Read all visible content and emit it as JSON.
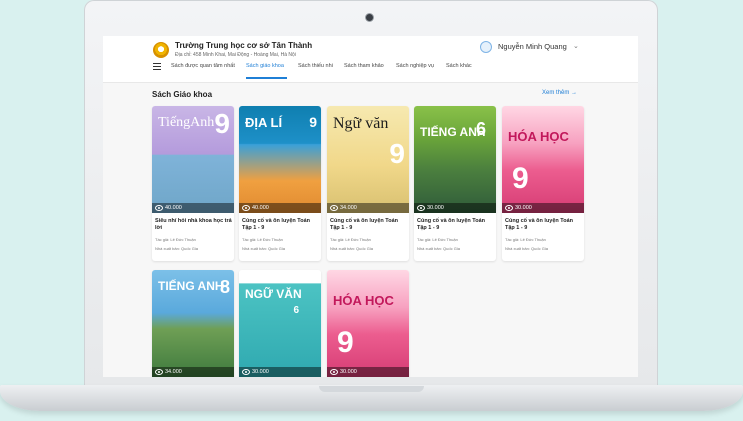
{
  "header": {
    "school_name": "Trường Trung học cơ sở Tân Thành",
    "school_address": "Địa chỉ: 458 Minh Khai, Mai Động - Hoàng Mai, Hà Nội",
    "user_name": "Nguyễn Minh Quang",
    "user_chevron": "⌄"
  },
  "nav": {
    "items": [
      {
        "label": "Sách được quan tâm nhất"
      },
      {
        "label": "Sách giáo khoa"
      },
      {
        "label": "Sách thiếu nhi"
      },
      {
        "label": "Sách tham khảo"
      },
      {
        "label": "Sách nghiệp vụ"
      },
      {
        "label": "Sách khác"
      }
    ],
    "active_index": 1
  },
  "section": {
    "title": "Sách Giáo khoa",
    "see_more": "Xem thêm →"
  },
  "books": [
    {
      "cover_title": "TiếngAnh",
      "cover_num": "9",
      "views": "40.000",
      "title": "Siêu nhí hỏi nhà khoa học trả lời",
      "author": "Tác giả: Lê Đức Thuận",
      "publisher": "Nhà xuất bản: Quốc Gia"
    },
    {
      "cover_title": "ĐỊA LÍ",
      "cover_num": "9",
      "views": "40.000",
      "title": "Củng cố và ôn luyện Toán Tập 1 - 9",
      "author": "Tác giả: Lê Đức Thuận",
      "publisher": "Nhà xuất bản: Quốc Gia"
    },
    {
      "cover_title": "Ngữ văn",
      "cover_num": "9",
      "views": "34.000",
      "title": "Củng cố và ôn luyện Toán Tập 1 - 9",
      "author": "Tác giả: Lê Đức Thuận",
      "publisher": "Nhà xuất bản: Quốc Gia"
    },
    {
      "cover_title": "TIẾNG ANH",
      "cover_num": "6",
      "views": "30.000",
      "title": "Củng cố và ôn luyện Toán Tập 1 - 9",
      "author": "Tác giả: Lê Đức Thuận",
      "publisher": "Nhà xuất bản: Quốc Gia"
    },
    {
      "cover_title": "HÓA HỌC",
      "cover_num": "9",
      "views": "30.000",
      "title": "Củng cố và ôn luyện Toán Tập 1 - 9",
      "author": "Tác giả: Lê Đức Thuận",
      "publisher": "Nhà xuất bản: Quốc Gia"
    },
    {
      "cover_title": "TIẾNG ANH",
      "cover_num": "8",
      "views": "34.000"
    },
    {
      "cover_title": "NGỮ VĂN",
      "cover_num": "6",
      "views": "30.000"
    },
    {
      "cover_title": "HÓA HỌC",
      "cover_num": "9",
      "views": "30.000"
    }
  ]
}
